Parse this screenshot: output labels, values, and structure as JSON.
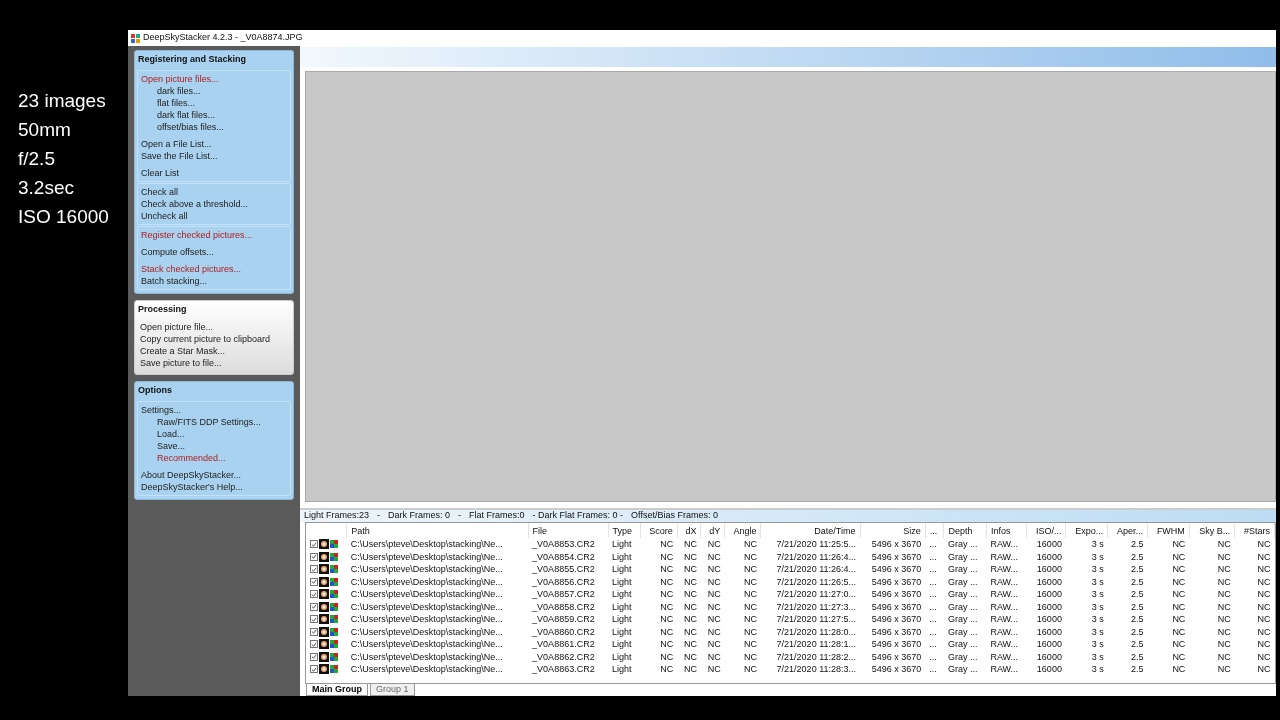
{
  "slide_notes": [
    "23 images",
    "50mm",
    "f/2.5",
    "3.2sec",
    "ISO 16000"
  ],
  "window": {
    "title": "DeepSkyStacker 4.2.3 - _V0A8874.JPG"
  },
  "panels": [
    {
      "title": "Registering and Stacking",
      "kind": "blue",
      "boxes": [
        {
          "groups": [
            [
              {
                "label": "Open picture files...",
                "highlighted": true,
                "children": [
                  {
                    "label": "dark files...",
                    "highlighted": false
                  },
                  {
                    "label": "flat files...",
                    "highlighted": false
                  },
                  {
                    "label": "dark flat files...",
                    "highlighted": false
                  },
                  {
                    "label": "offset/bias files...",
                    "highlighted": false
                  }
                ]
              }
            ],
            [
              {
                "label": "Open a File List...",
                "highlighted": false
              },
              {
                "label": "Save the File List...",
                "highlighted": false
              }
            ],
            [
              {
                "label": "Clear List",
                "highlighted": false
              }
            ]
          ]
        },
        {
          "groups": [
            [
              {
                "label": "Check all",
                "highlighted": false
              },
              {
                "label": "Check above a threshold...",
                "highlighted": false
              },
              {
                "label": "Uncheck all",
                "highlighted": false
              }
            ]
          ]
        },
        {
          "groups": [
            [
              {
                "label": "Register checked pictures...",
                "highlighted": true
              }
            ],
            [
              {
                "label": "Compute offsets...",
                "highlighted": false
              }
            ],
            [
              {
                "label": "Stack checked pictures...",
                "highlighted": true
              },
              {
                "label": "Batch stacking...",
                "highlighted": false
              }
            ]
          ]
        }
      ]
    },
    {
      "title": "Processing",
      "kind": "light",
      "boxes": [
        {
          "groups": [
            [
              {
                "label": "Open picture file...",
                "highlighted": false
              },
              {
                "label": "Copy current picture to clipboard",
                "highlighted": false
              },
              {
                "label": "Create a Star Mask...",
                "highlighted": false
              },
              {
                "label": "Save picture to file...",
                "highlighted": false
              }
            ]
          ]
        }
      ]
    },
    {
      "title": "Options",
      "kind": "blue",
      "boxes": [
        {
          "groups": [
            [
              {
                "label": "Settings...",
                "highlighted": false,
                "children": [
                  {
                    "label": "Raw/FITS DDP Settings...",
                    "highlighted": false
                  },
                  {
                    "label": "Load...",
                    "highlighted": false
                  },
                  {
                    "label": "Save...",
                    "highlighted": false
                  },
                  {
                    "label": "Recommended...",
                    "highlighted": true
                  }
                ]
              }
            ],
            [
              {
                "label": "About DeepSkyStacker...",
                "highlighted": false
              },
              {
                "label": "DeepSkyStacker's Help...",
                "highlighted": false
              }
            ]
          ]
        }
      ]
    }
  ],
  "status_bar": [
    "Light Frames:23",
    "-",
    "Dark Frames: 0",
    "-",
    "Flat Frames:0",
    "- Dark Flat Frames: 0 -",
    "Offset/Bias Frames: 0"
  ],
  "table": {
    "columns": [
      "Path",
      "File",
      "Type",
      "Score",
      "dX",
      "dY",
      "Angle",
      "Date/Time",
      "Size",
      "...",
      "Depth",
      "Infos",
      "ISO/...",
      "Expo...",
      "Aper...",
      "FWHM",
      "Sky B...",
      "#Stars"
    ],
    "rows": [
      {
        "checked": true,
        "cells": [
          "C:\\Users\\pteve\\Desktop\\stacking\\Ne...",
          "_V0A8853.CR2",
          "Light",
          "NC",
          "NC",
          "NC",
          "NC",
          "7/21/2020 11:25:5...",
          "5496 x 3670",
          "...",
          "Gray ...",
          "RAW...",
          "16000",
          "3 s",
          "2.5",
          "NC",
          "NC",
          "NC"
        ]
      },
      {
        "checked": true,
        "cells": [
          "C:\\Users\\pteve\\Desktop\\stacking\\Ne...",
          "_V0A8854.CR2",
          "Light",
          "NC",
          "NC",
          "NC",
          "NC",
          "7/21/2020 11:26:4...",
          "5496 x 3670",
          "...",
          "Gray ...",
          "RAW...",
          "16000",
          "3 s",
          "2.5",
          "NC",
          "NC",
          "NC"
        ]
      },
      {
        "checked": true,
        "cells": [
          "C:\\Users\\pteve\\Desktop\\stacking\\Ne...",
          "_V0A8855.CR2",
          "Light",
          "NC",
          "NC",
          "NC",
          "NC",
          "7/21/2020 11:26:4...",
          "5496 x 3670",
          "...",
          "Gray ...",
          "RAW...",
          "16000",
          "3 s",
          "2.5",
          "NC",
          "NC",
          "NC"
        ]
      },
      {
        "checked": true,
        "cells": [
          "C:\\Users\\pteve\\Desktop\\stacking\\Ne...",
          "_V0A8856.CR2",
          "Light",
          "NC",
          "NC",
          "NC",
          "NC",
          "7/21/2020 11:26:5...",
          "5496 x 3670",
          "...",
          "Gray ...",
          "RAW...",
          "16000",
          "3 s",
          "2.5",
          "NC",
          "NC",
          "NC"
        ]
      },
      {
        "checked": true,
        "cells": [
          "C:\\Users\\pteve\\Desktop\\stacking\\Ne...",
          "_V0A8857.CR2",
          "Light",
          "NC",
          "NC",
          "NC",
          "NC",
          "7/21/2020 11:27:0...",
          "5496 x 3670",
          "...",
          "Gray ...",
          "RAW...",
          "16000",
          "3 s",
          "2.5",
          "NC",
          "NC",
          "NC"
        ]
      },
      {
        "checked": true,
        "cells": [
          "C:\\Users\\pteve\\Desktop\\stacking\\Ne...",
          "_V0A8858.CR2",
          "Light",
          "NC",
          "NC",
          "NC",
          "NC",
          "7/21/2020 11:27:3...",
          "5496 x 3670",
          "...",
          "Gray ...",
          "RAW...",
          "16000",
          "3 s",
          "2.5",
          "NC",
          "NC",
          "NC"
        ]
      },
      {
        "checked": true,
        "cells": [
          "C:\\Users\\pteve\\Desktop\\stacking\\Ne...",
          "_V0A8859.CR2",
          "Light",
          "NC",
          "NC",
          "NC",
          "NC",
          "7/21/2020 11:27:5...",
          "5496 x 3670",
          "...",
          "Gray ...",
          "RAW...",
          "16000",
          "3 s",
          "2.5",
          "NC",
          "NC",
          "NC"
        ]
      },
      {
        "checked": true,
        "cells": [
          "C:\\Users\\pteve\\Desktop\\stacking\\Ne...",
          "_V0A8860.CR2",
          "Light",
          "NC",
          "NC",
          "NC",
          "NC",
          "7/21/2020 11:28:0...",
          "5496 x 3670",
          "...",
          "Gray ...",
          "RAW...",
          "16000",
          "3 s",
          "2.5",
          "NC",
          "NC",
          "NC"
        ]
      },
      {
        "checked": true,
        "cells": [
          "C:\\Users\\pteve\\Desktop\\stacking\\Ne...",
          "_V0A8861.CR2",
          "Light",
          "NC",
          "NC",
          "NC",
          "NC",
          "7/21/2020 11:28:1...",
          "5496 x 3670",
          "...",
          "Gray ...",
          "RAW...",
          "16000",
          "3 s",
          "2.5",
          "NC",
          "NC",
          "NC"
        ]
      },
      {
        "checked": true,
        "cells": [
          "C:\\Users\\pteve\\Desktop\\stacking\\Ne...",
          "_V0A8862.CR2",
          "Light",
          "NC",
          "NC",
          "NC",
          "NC",
          "7/21/2020 11:28:2...",
          "5496 x 3670",
          "...",
          "Gray ...",
          "RAW...",
          "16000",
          "3 s",
          "2.5",
          "NC",
          "NC",
          "NC"
        ]
      },
      {
        "checked": true,
        "cells": [
          "C:\\Users\\pteve\\Desktop\\stacking\\Ne...",
          "_V0A8863.CR2",
          "Light",
          "NC",
          "NC",
          "NC",
          "NC",
          "7/21/2020 11:28:3...",
          "5496 x 3670",
          "...",
          "Gray ...",
          "RAW...",
          "16000",
          "3 s",
          "2.5",
          "NC",
          "NC",
          "NC"
        ]
      }
    ]
  },
  "tabs": [
    {
      "label": "Main Group",
      "selected": true
    },
    {
      "label": "Group 1",
      "selected": false
    }
  ]
}
